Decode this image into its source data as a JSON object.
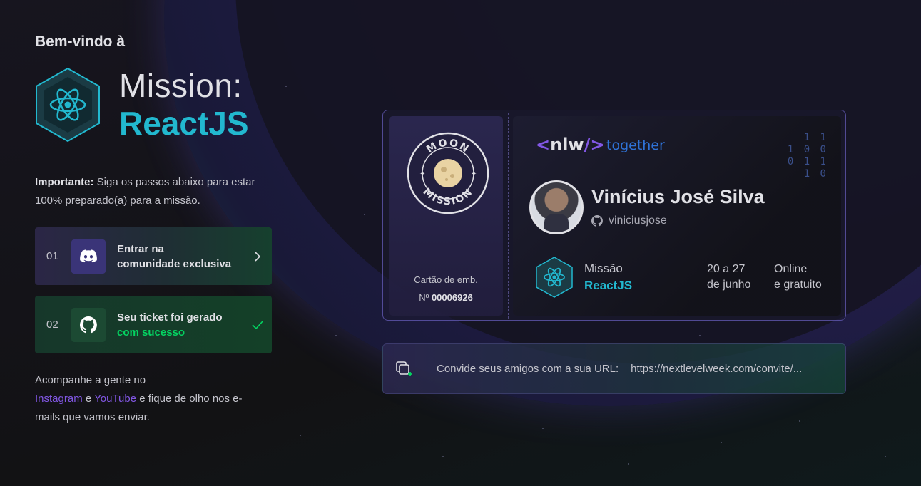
{
  "header": {
    "welcome": "Bem-vindo à",
    "title_line1": "Mission:",
    "title_line2": "ReactJS"
  },
  "intro": {
    "bold": "Importante:",
    "text": " Siga os passos abaixo para estar 100% preparado(a) para a missão."
  },
  "steps": [
    {
      "number": "01",
      "icon": "discord-icon",
      "line1": "Entrar na",
      "line2": "comunidade exclusiva",
      "action_icon": "chevron-right-icon"
    },
    {
      "number": "02",
      "icon": "github-icon",
      "line1": "Seu ticket foi gerado",
      "line2": "com sucesso",
      "action_icon": "check-icon"
    }
  ],
  "follow": {
    "prefix": "Acompanhe a gente no",
    "instagram": "Instagram",
    "conj": " e ",
    "youtube": "YouTube",
    "suffix": " e fique de olho nos e-mails que vamos enviar."
  },
  "ticket": {
    "seal_top": "MOON",
    "seal_bottom": "MISSION",
    "card_caption": "Cartão de emb.",
    "card_prefix": "Nº ",
    "card_number": "00006926",
    "brand_left": "<",
    "brand_word": "nlw",
    "brand_right": "/>",
    "brand_tag": "together",
    "binary": [
      "1 1",
      "1 0 0",
      "0 1 1",
      "1 0"
    ],
    "user_name": "Vinícius José Silva",
    "github_user": "viniciusjose",
    "mission_label": "Missão",
    "mission_value": "ReactJS",
    "date_line1": "20 a 27",
    "date_line2": "de junho",
    "mode_line1": "Online",
    "mode_line2": "e gratuito"
  },
  "invite": {
    "label": "Convide seus amigos com a sua URL:",
    "url": "https://nextlevelweek.com/convite/..."
  },
  "colors": {
    "accent_cyan": "#22b8cf",
    "accent_purple": "#8257e5",
    "success_green": "#04d361"
  }
}
